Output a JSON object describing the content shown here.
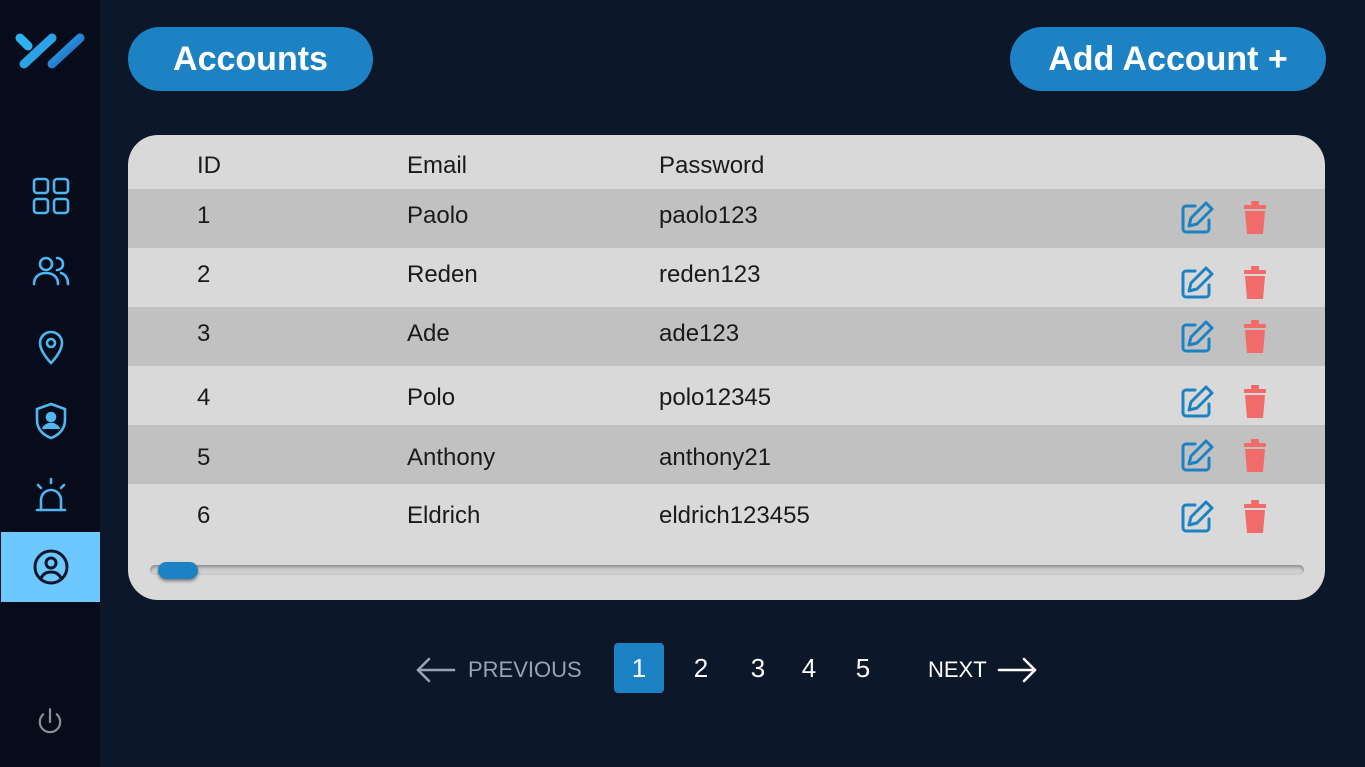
{
  "header": {
    "title": "Accounts",
    "add_button_label": "Add Account +"
  },
  "sidebar": {
    "items": [
      {
        "name": "dashboard",
        "icon": "grid-icon",
        "active": false
      },
      {
        "name": "users",
        "icon": "users-icon",
        "active": false
      },
      {
        "name": "locations",
        "icon": "location-pin-icon",
        "active": false
      },
      {
        "name": "security",
        "icon": "shield-user-icon",
        "active": false
      },
      {
        "name": "alerts",
        "icon": "alarm-siren-icon",
        "active": false
      },
      {
        "name": "accounts",
        "icon": "user-circle-icon",
        "active": true
      }
    ],
    "power_icon": "power-icon"
  },
  "table": {
    "columns": [
      "ID",
      "Email",
      "Password"
    ],
    "rows": [
      {
        "id": "1",
        "email": "Paolo",
        "password": "paolo123"
      },
      {
        "id": "2",
        "email": "Reden",
        "password": "reden123"
      },
      {
        "id": "3",
        "email": "Ade",
        "password": "ade123"
      },
      {
        "id": "4",
        "email": "Polo",
        "password": "polo12345"
      },
      {
        "id": "5",
        "email": "Anthony",
        "password": "anthony21"
      },
      {
        "id": "6",
        "email": "Eldrich",
        "password": "eldrich123455"
      }
    ]
  },
  "pagination": {
    "prev_label": "PREVIOUS",
    "next_label": "NEXT",
    "pages": [
      "1",
      "2",
      "3",
      "4",
      "5"
    ],
    "current_page": "1"
  },
  "colors": {
    "background": "#0d172a",
    "sidebar": "#060c1a",
    "accent": "#1c82c4",
    "active_nav": "#6cc8ff",
    "delete": "#f26b6b",
    "edit": "#1c82c4"
  }
}
